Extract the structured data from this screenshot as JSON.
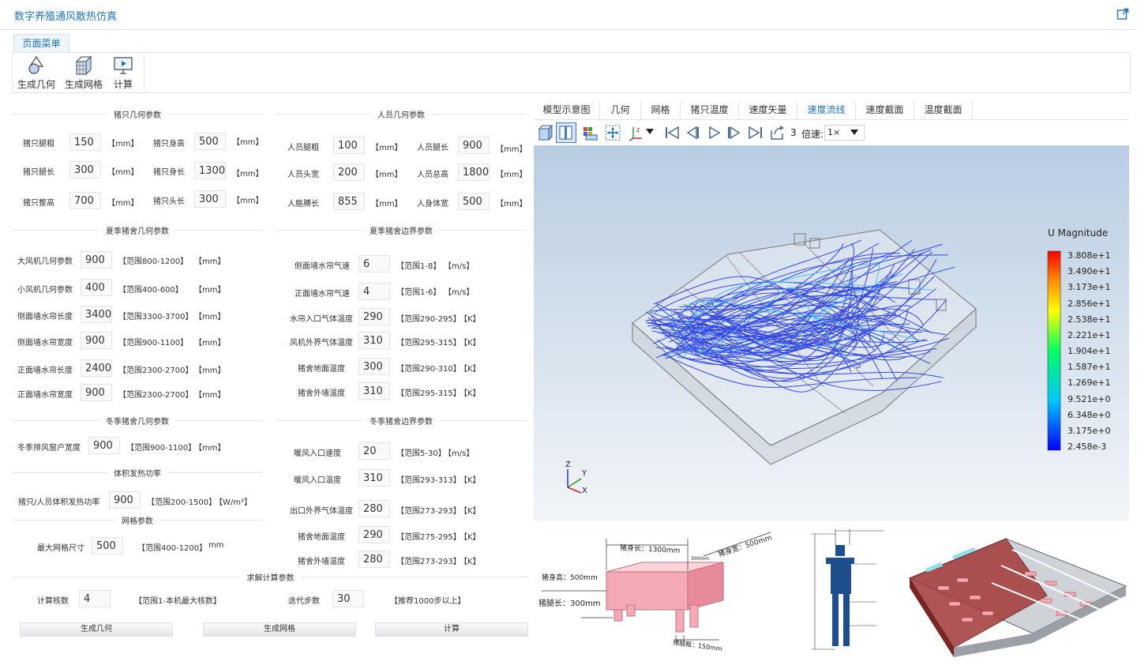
{
  "app": {
    "title": "数字养殖通风散热仿真"
  },
  "menu": {
    "tab_label": "页面菜单"
  },
  "ribbon": [
    {
      "label": "生成几何",
      "icon": "geometry-icon"
    },
    {
      "label": "生成网格",
      "icon": "mesh-icon"
    },
    {
      "label": "计算",
      "icon": "compute-icon"
    }
  ],
  "pig_geometry": {
    "title": "猪只几何参数",
    "leg_width": {
      "label": "猪只腿粗",
      "value": "150",
      "unit": "【mm】"
    },
    "body_height": {
      "label": "猪只身高",
      "value": "500",
      "unit": "【mm】"
    },
    "leg_length": {
      "label": "猪只腿长",
      "value": "300",
      "unit": "【mm】"
    },
    "body_length": {
      "label": "猪只身长",
      "value": "1300",
      "unit": "【mm】"
    },
    "total_height": {
      "label": "猪只整高",
      "value": "700",
      "unit": "【mm】"
    },
    "head_length": {
      "label": "猪只头长",
      "value": "300",
      "unit": "【mm】"
    }
  },
  "person_geometry": {
    "title": "人员几何参数",
    "leg_width": {
      "label": "人员腿粗",
      "value": "100",
      "unit": "【mm】"
    },
    "leg_length": {
      "label": "人员腿长",
      "value": "900",
      "unit": "【mm】"
    },
    "head_width": {
      "label": "人员头宽",
      "value": "200",
      "unit": "【mm】"
    },
    "total_height": {
      "label": "人员总高",
      "value": "1800",
      "unit": "【mm】"
    },
    "arm_length": {
      "label": "人胳膊长",
      "value": "855",
      "unit": "【mm】"
    },
    "body_width": {
      "label": "人身体宽",
      "value": "500",
      "unit": "【mm】"
    }
  },
  "summer_geometry": {
    "title": "夏季猪舍几何参数",
    "rows": [
      {
        "label": "大风机几何参数",
        "value": "900",
        "range": "【范围800-1200】",
        "unit": "【mm】"
      },
      {
        "label": "小风机几何参数",
        "value": "400",
        "range": "【范围400-600】",
        "unit": "【mm】"
      },
      {
        "label": "侧面墙水帘长度",
        "value": "3400",
        "range": "【范围3300-3700】",
        "unit": "【mm】"
      },
      {
        "label": "侧面墙水帘宽度",
        "value": "900",
        "range": "【范围900-1100】",
        "unit": "【mm】"
      },
      {
        "label": "正面墙水帘长度",
        "value": "2400",
        "range": "【范围2300-2700】",
        "unit": "【mm】"
      },
      {
        "label": "正面墙水帘宽度",
        "value": "900",
        "range": "【范围2300-2700】",
        "unit": "【mm】"
      }
    ]
  },
  "summer_boundary": {
    "title": "夏季猪舍边界参数",
    "rows": [
      {
        "label": "侧面墙水帘气速",
        "value": "6",
        "range": "【范围1-8】",
        "unit": "【m/s】"
      },
      {
        "label": "正面墙水帘气速",
        "value": "4",
        "range": "【范围1-6】",
        "unit": "【m/s】"
      },
      {
        "label": "水帘入口气体温度",
        "value": "290",
        "range": "【范围290-295】",
        "unit": "【K】"
      },
      {
        "label": "风机外界气体温度",
        "value": "310",
        "range": "【范围295-315】",
        "unit": "【K】"
      },
      {
        "label": "猪舍地面温度",
        "value": "300",
        "range": "【范围290-310】",
        "unit": "【K】"
      },
      {
        "label": "猪舍外墙温度",
        "value": "310",
        "range": "【范围295-315】",
        "unit": "【K】"
      }
    ]
  },
  "winter_geometry": {
    "title": "冬季猪舍几何参数",
    "window_width": {
      "label": "冬季排风窗户宽度",
      "value": "900",
      "range": "【范围900-1100】",
      "unit": "【mm】"
    }
  },
  "heat": {
    "title": "体积发热功率",
    "power": {
      "label": "猪只/人员体积发热功率",
      "value": "900",
      "range": "【范围200-1500】",
      "unit": "【W/m³】"
    }
  },
  "mesh": {
    "title": "网格参数",
    "max_size": {
      "label": "最大网格尺寸",
      "value": "500",
      "range": "【范围400-1200】",
      "unit": "mm"
    }
  },
  "winter_boundary": {
    "title": "冬季猪舍边界参数",
    "rows": [
      {
        "label": "暖风入口速度",
        "value": "20",
        "range": "【范围5-30】",
        "unit": "【m/s】"
      },
      {
        "label": "暖风入口温度",
        "value": "310",
        "range": "【范围293-313】",
        "unit": "【K】"
      },
      {
        "label": "出口外界气体温度",
        "value": "280",
        "range": "【范围273-293】",
        "unit": "【K】"
      },
      {
        "label": "猪舍地面温度",
        "value": "290",
        "range": "【范围275-295】",
        "unit": "【K】"
      },
      {
        "label": "猪舍外墙温度",
        "value": "280",
        "range": "【范围273-293】",
        "unit": "【K】"
      }
    ]
  },
  "solver": {
    "title": "求解计算参数",
    "cores": {
      "label": "计算核数",
      "value": "4",
      "range": "【范围1-本机最大核数】"
    },
    "steps": {
      "label": "迭代步数",
      "value": "30",
      "range": "【推荐1000步以上】"
    }
  },
  "actions": {
    "gen_geometry": "生成几何",
    "gen_mesh": "生成网格",
    "compute": "计算"
  },
  "viewer": {
    "tabs": [
      "模型示意图",
      "几何",
      "网格",
      "猪只温度",
      "速度矢量",
      "速度流线",
      "速度截面",
      "温度截面"
    ],
    "active_tab": 5,
    "frame": "3",
    "speed_label": "倍速:",
    "speed_value": "1×"
  },
  "legend": {
    "title": "U Magnitude",
    "ticks": [
      "3.808e+1",
      "3.490e+1",
      "3.173e+1",
      "2.856e+1",
      "2.538e+1",
      "2.221e+1",
      "1.904e+1",
      "1.587e+1",
      "1.269e+1",
      "9.521e+0",
      "6.348e+0",
      "3.175e+0",
      "2.458e-3"
    ]
  },
  "axes": {
    "z": "Z",
    "y": "Y",
    "x": "X"
  },
  "diagram_pig": {
    "body_length": "猪身长：1300mm",
    "body_width": "猪身宽：500mm",
    "body_height": "猪身高：500mm",
    "leg_length": "猪腿长：300mm",
    "leg_width": "猪腿粗：150mm",
    "head": "300mm"
  },
  "colors": {
    "accent": "#1e73be",
    "pig": "#f4aab6",
    "person": "#1f4e8c",
    "building": "#a33838"
  }
}
